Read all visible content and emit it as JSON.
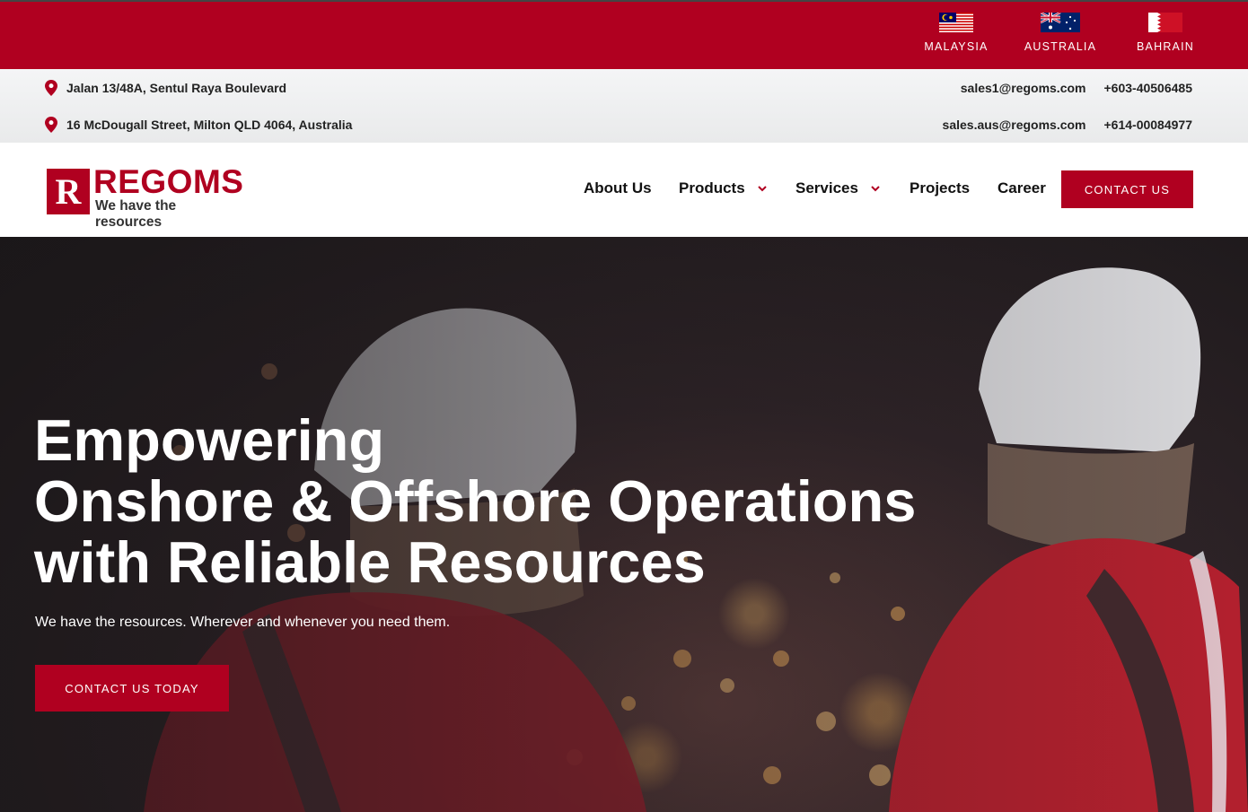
{
  "countries": [
    {
      "name": "MALAYSIA",
      "icon": "malaysia-flag-icon"
    },
    {
      "name": "AUSTRALIA",
      "icon": "australia-flag-icon"
    },
    {
      "name": "BAHRAIN",
      "icon": "bahrain-flag-icon"
    }
  ],
  "contact": {
    "address_1": "Jalan 13/48A, Sentul Raya Boulevard",
    "address_2": "16 McDougall Street, Milton QLD 4064, Australia",
    "email_1": "sales1@regoms.com",
    "phone_1": "+603-40506485",
    "email_2": "sales.aus@regoms.com",
    "phone_2": "+614-00084977",
    "icon": "map-pin-icon"
  },
  "brand": {
    "letter": "R",
    "name": "REGOMS",
    "tagline": "We have the resources"
  },
  "nav": {
    "about": "About Us",
    "products": "Products",
    "services": "Services",
    "projects": "Projects",
    "career": "Career",
    "cta": "CONTACT US"
  },
  "hero": {
    "title_line1": "Empowering",
    "title_line2": "Onshore & Offshore Operations",
    "title_line3": "with Reliable Resources",
    "subtitle": "We have the resources. Wherever and whenever you need them.",
    "cta": "CONTACT US TODAY"
  },
  "colors": {
    "brand_red": "#b00020",
    "topbar": "#b00020",
    "info_bg": "#eef0f1"
  }
}
